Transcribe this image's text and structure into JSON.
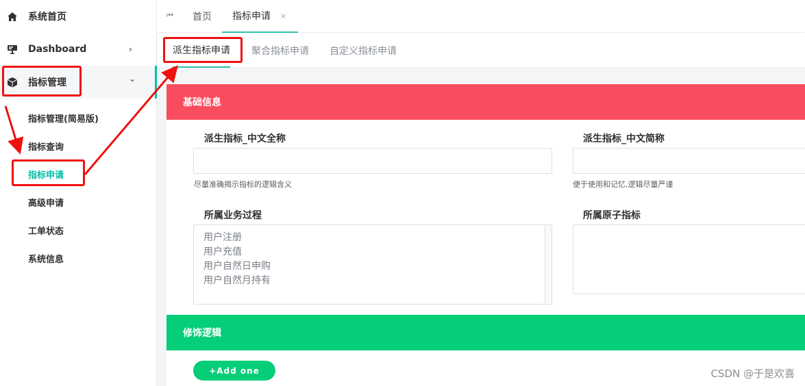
{
  "sidebar": {
    "items": [
      {
        "label": "系统首页",
        "icon": "home-icon"
      },
      {
        "label": "Dashboard",
        "icon": "dashboard-icon",
        "arrow": "›"
      },
      {
        "label": "指标管理",
        "icon": "cube-icon",
        "arrow": "⌄"
      }
    ],
    "sub_items": [
      {
        "label": "指标管理(简易版)"
      },
      {
        "label": "指标查询"
      },
      {
        "label": "指标申请"
      },
      {
        "label": "高级申请"
      },
      {
        "label": "工单状态"
      },
      {
        "label": "系统信息"
      }
    ]
  },
  "topbar": {
    "first_icon": "⏮",
    "tabs": [
      {
        "label": "首页"
      },
      {
        "label": "指标申请",
        "close": "×"
      }
    ]
  },
  "subtabs": [
    {
      "label": "派生指标申请"
    },
    {
      "label": "聚合指标申请"
    },
    {
      "label": "自定义指标申请"
    }
  ],
  "form": {
    "basic_section": {
      "title": "基础信息"
    },
    "full_name": {
      "label": "派生指标_中文全称",
      "value": "",
      "hint": "尽量准确揭示指标的逻辑含义"
    },
    "short_name": {
      "label": "派生指标_中文简称",
      "value": "",
      "hint": "便于使用和记忆,逻辑尽量严谨"
    },
    "business_process": {
      "label": "所属业务过程",
      "options": [
        "用户注册",
        "用户充值",
        "用户自然日申购",
        "用户自然月持有"
      ]
    },
    "atomic_metric": {
      "label": "所属原子指标"
    },
    "modifier_section": {
      "title": "修饰逻辑"
    },
    "add_button": "+Add one"
  },
  "colors": {
    "accent": "#00bfa5",
    "basic_header": "#f94c5f",
    "modifier_header": "#04ce78",
    "annotation": "#f01010"
  },
  "watermark": "CSDN @于是欢喜"
}
